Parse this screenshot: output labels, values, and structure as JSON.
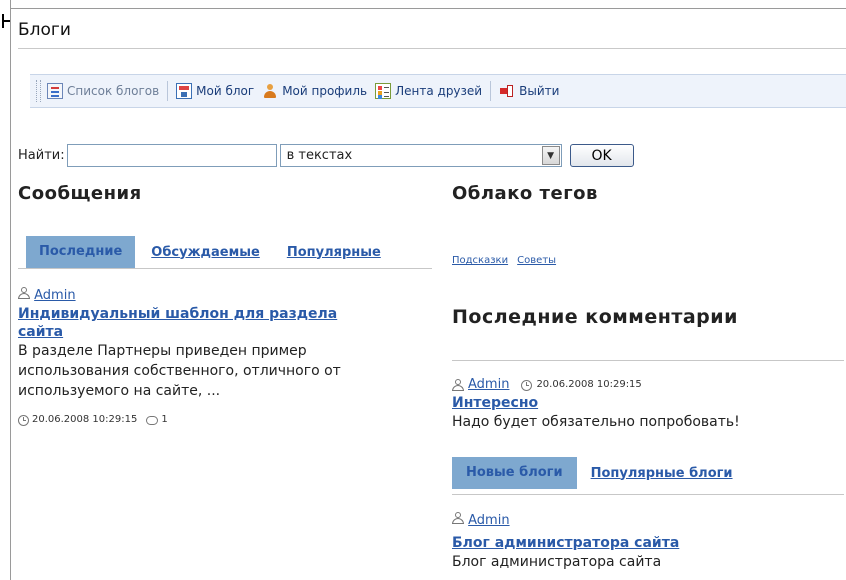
{
  "page": {
    "title": "Блоги"
  },
  "toolbar": {
    "items": [
      {
        "label": "Список блогов",
        "icon": "blog-list-icon",
        "active": false
      },
      {
        "label": "Мой блог",
        "icon": "my-blog-icon"
      },
      {
        "label": "Мой профиль",
        "icon": "profile-icon"
      },
      {
        "label": "Лента друзей",
        "icon": "friends-feed-icon"
      },
      {
        "label": "Выйти",
        "icon": "logout-icon"
      }
    ]
  },
  "search": {
    "label": "Найти:",
    "value": "",
    "scope": "в текстах",
    "submit": "OK"
  },
  "messages": {
    "heading": "Сообщения",
    "tabs": [
      "Последние",
      "Обсуждаемые",
      "Популярные"
    ],
    "post": {
      "author": "Admin",
      "title_line1": "Индивидуальный шаблон для раздела",
      "title_line2": "сайта",
      "text_line1": "В разделе Партнеры приведен пример",
      "text_line2": "использования собственного, отличного от",
      "text_line3": "используемого на сайте, ...",
      "date": "20.06.2008 10:29:15",
      "comments": "1"
    }
  },
  "tag_cloud": {
    "heading": "Облако тегов",
    "tags": [
      "Подсказки",
      "Советы"
    ]
  },
  "last_comments": {
    "heading": "Последние комментарии",
    "item": {
      "author": "Admin",
      "date": "20.06.2008 10:29:15",
      "title": "Интересно",
      "text": "Надо будет обязательно попробовать!"
    }
  },
  "blogs": {
    "tabs": [
      "Новые блоги",
      "Популярные блоги"
    ],
    "item": {
      "author": "Admin",
      "title": "Блог администратора сайта",
      "text": "Блог администратора сайта"
    }
  }
}
